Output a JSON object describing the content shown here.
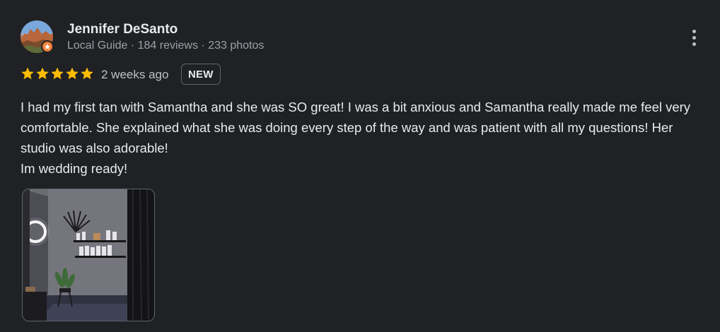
{
  "reviewer": {
    "name": "Jennifer DeSanto",
    "meta": "Local Guide · 184 reviews · 233 photos",
    "avatar_icon": "reviewer-avatar",
    "badge_icon": "local-guide-star-icon"
  },
  "review": {
    "rating": 5,
    "max_rating": 5,
    "time": "2 weeks ago",
    "badge": "NEW",
    "paragraphs": [
      "I had my first tan with Samantha and she was SO great! I was a bit anxious and Samantha really made me feel very comfortable. She explained what she was doing every step of the way and was patient with all my questions! Her studio was also adorable!",
      "Im wedding ready!"
    ]
  },
  "colors": {
    "background": "#202124",
    "star": "#fbbc04",
    "guide_badge": "#f1803a"
  },
  "menu_icon": "more-vert-icon"
}
